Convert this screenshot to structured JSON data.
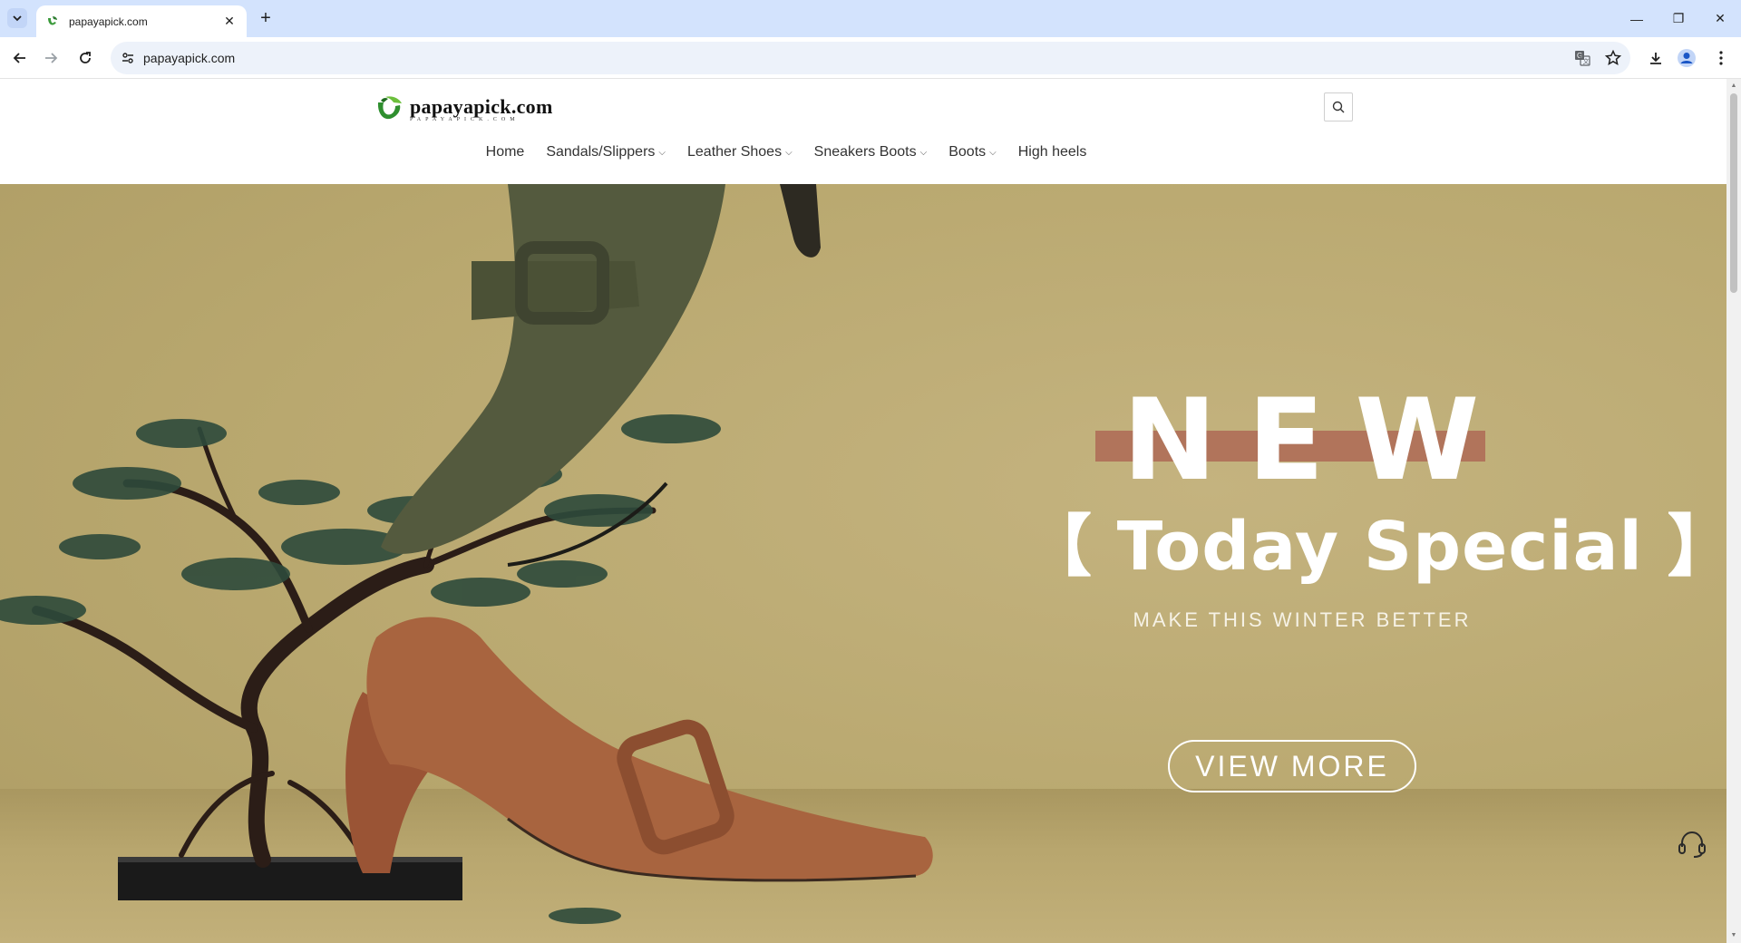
{
  "browser": {
    "tab_title": "papayapick.com",
    "tab_close": "✕",
    "new_tab": "+",
    "url": "papayapick.com"
  },
  "window": {
    "minimize": "—",
    "restore": "❐",
    "close": "✕"
  },
  "site": {
    "logo_text": "papayapick.com",
    "logo_sub": "PAPAYAPICK.COM",
    "nav": [
      {
        "label": "Home",
        "dropdown": false
      },
      {
        "label": "Sandals/Slippers",
        "dropdown": true
      },
      {
        "label": "Leather Shoes",
        "dropdown": true
      },
      {
        "label": "Sneakers Boots",
        "dropdown": true
      },
      {
        "label": "Boots",
        "dropdown": true
      },
      {
        "label": "High heels",
        "dropdown": false
      }
    ],
    "chevron": "⌵"
  },
  "hero": {
    "headline": "NEW",
    "subheadline": "【 Today Special 】",
    "tagline": "MAKE THIS WINTER BETTER",
    "cta": "VIEW  MORE"
  },
  "colors": {
    "hero_bg": "#b9a86f",
    "new_bar": "#b06f58",
    "tabbar": "#d3e3fd",
    "omnibox": "#edf2fa"
  },
  "icons": [
    "tab-list-icon",
    "favicon-icon",
    "close-icon",
    "plus-icon",
    "back-icon",
    "forward-icon",
    "reload-icon",
    "site-info-icon",
    "translate-icon",
    "star-icon",
    "download-icon",
    "profile-icon",
    "menu-icon",
    "search-icon",
    "headset-icon"
  ]
}
